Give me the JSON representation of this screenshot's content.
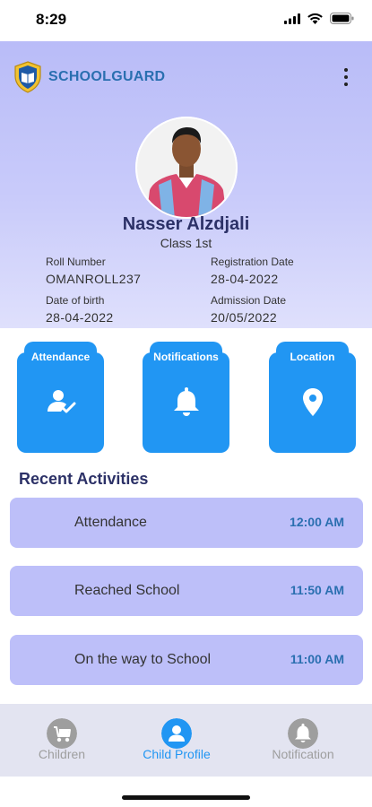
{
  "status_bar": {
    "time": "8:29"
  },
  "header": {
    "app_name": "SCHOOLGUARD",
    "student_name": "Nasser Alzdjali",
    "class": "Class 1st",
    "info": [
      {
        "label": "Roll Number",
        "value": "OMANROLL237"
      },
      {
        "label": "Registration Date",
        "value": "28-04-2022"
      },
      {
        "label": "Date of birth",
        "value": "28-04-2022"
      },
      {
        "label": "Admission Date",
        "value": "20/05/2022"
      }
    ]
  },
  "cards": [
    {
      "label": "Attendance",
      "icon": "user-check-icon"
    },
    {
      "label": "Notifications",
      "icon": "bell-icon"
    },
    {
      "label": "Location",
      "icon": "map-pin-icon"
    }
  ],
  "recent": {
    "title": "Recent Activities",
    "items": [
      {
        "name": "Attendance",
        "time": "12:00 AM"
      },
      {
        "name": "Reached School",
        "time": "11:50 AM"
      },
      {
        "name": "On the way to School",
        "time": "11:00 AM"
      }
    ]
  },
  "bottom_nav": {
    "items": [
      {
        "label": "Children",
        "icon": "stroller-icon",
        "active": false
      },
      {
        "label": "Child Profile",
        "icon": "person-icon",
        "active": true
      },
      {
        "label": "Notification",
        "icon": "bell-icon",
        "active": false
      }
    ]
  },
  "colors": {
    "accent": "#2196f3",
    "header_gradient_top": "#b9bcf8",
    "activity_bg": "#bdbff9",
    "title_navy": "#2c3167",
    "time_blue": "#2a6fb0",
    "nav_inactive": "#9e9e9e"
  }
}
